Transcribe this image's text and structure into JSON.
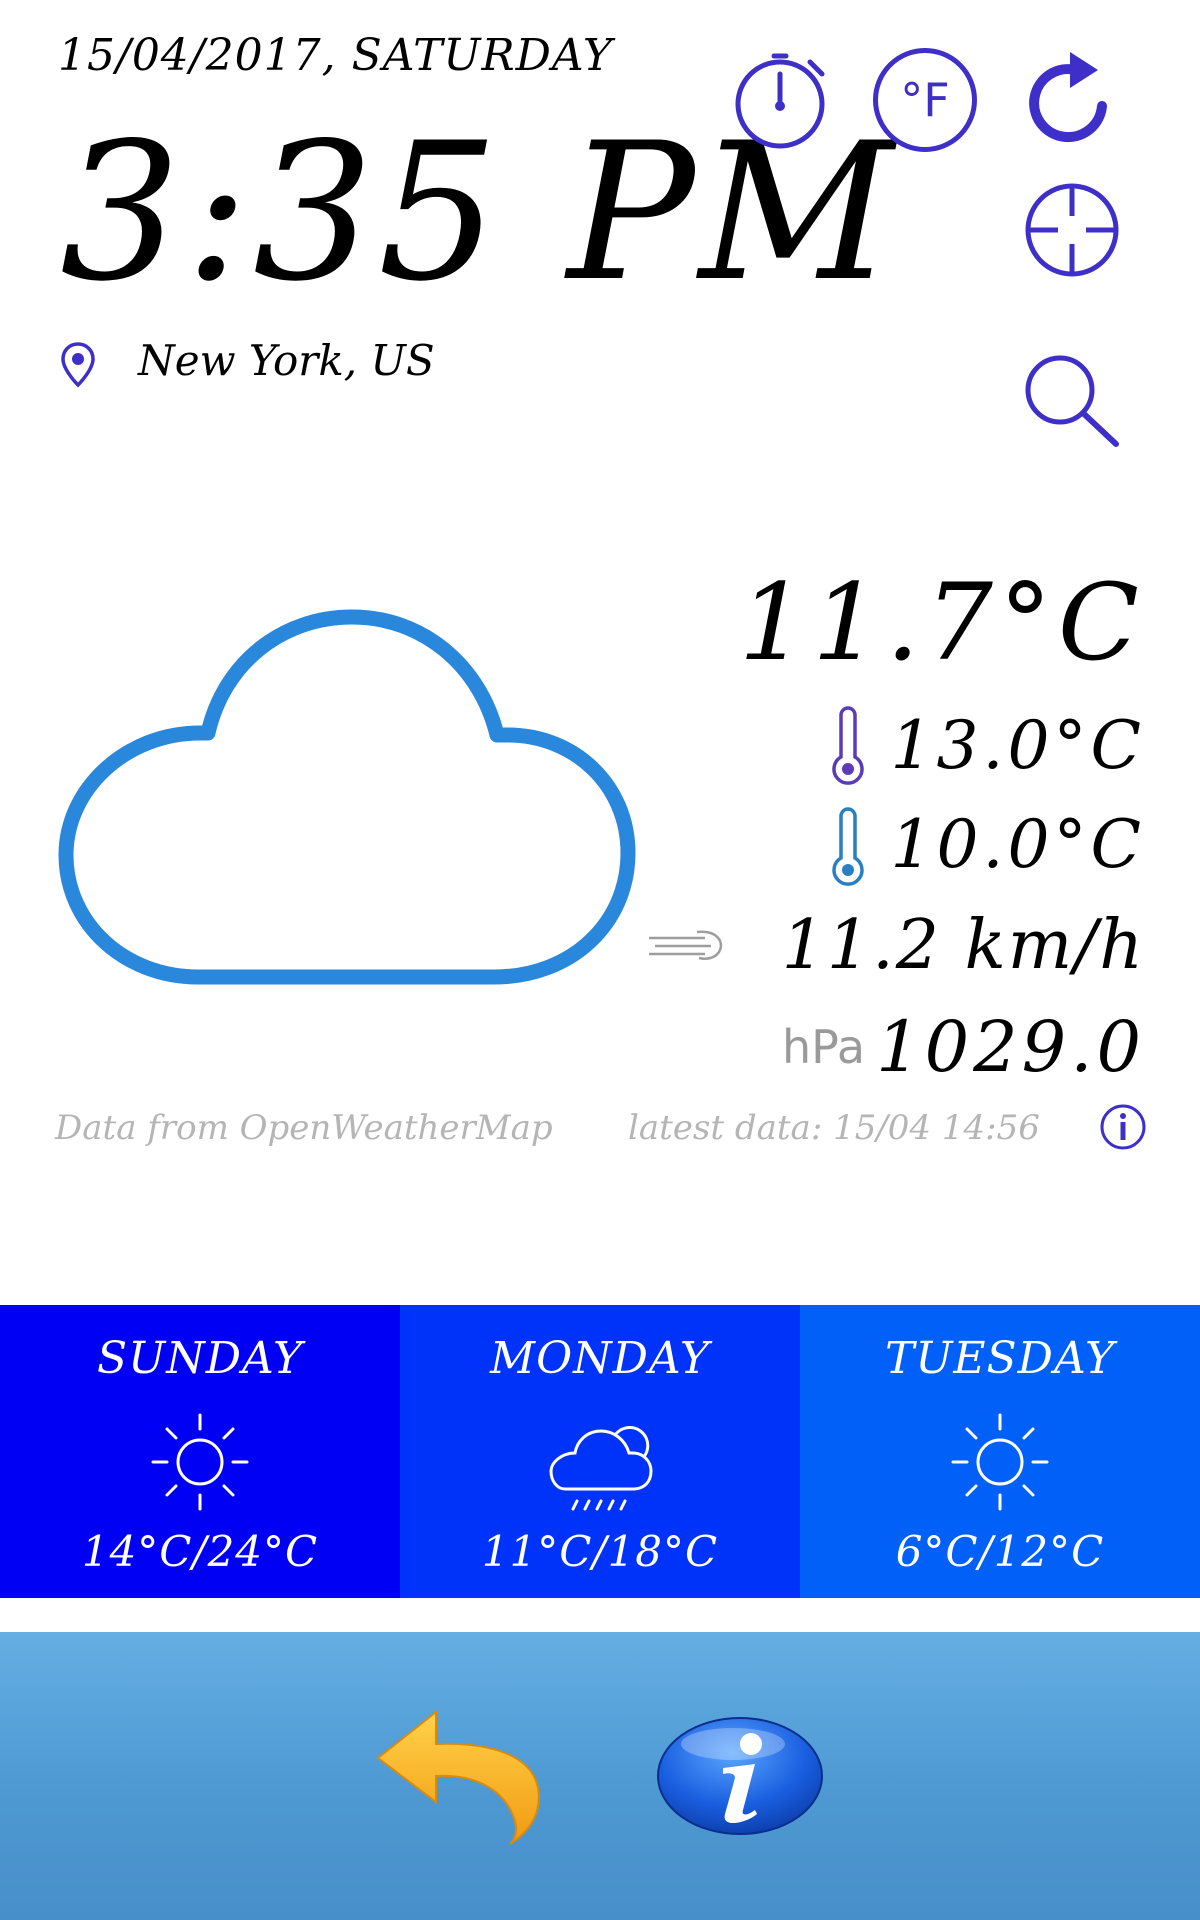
{
  "header": {
    "date": "15/04/2017, SATURDAY",
    "time": "3:35 PM",
    "location": "New York, US"
  },
  "icons": {
    "timer": "stopwatch-icon",
    "unit_toggle": "fahrenheit-icon",
    "unit_toggle_label": "°F",
    "refresh": "refresh-icon",
    "locate": "crosshair-icon",
    "search": "search-icon",
    "location": "location-pin-icon",
    "condition": "cloud-icon"
  },
  "current": {
    "temperature": "11.7°C",
    "max_temperature": "13.0°C",
    "min_temperature": "10.0°C",
    "wind_speed": "11.2 km/h",
    "pressure_unit": "hPa",
    "pressure": "1029.0"
  },
  "footer_info": {
    "source": "Data from OpenWeatherMap",
    "latest": "latest data: 15/04 14:56"
  },
  "forecast": [
    {
      "day": "SUNDAY",
      "icon": "sun-icon",
      "range": "14°C/24°C",
      "color": "#0000f5"
    },
    {
      "day": "MONDAY",
      "icon": "rain-cloud-icon",
      "range": "11°C/18°C",
      "color": "#0033fa"
    },
    {
      "day": "TUESDAY",
      "icon": "sun-icon",
      "range": "6°C/12°C",
      "color": "#0060f8"
    }
  ],
  "colors": {
    "accent": "#3d2fc8",
    "cloud": "#2a88dc",
    "bottom_bar": "#5aa3dc",
    "back_arrow": "#f6a81a"
  },
  "bottom_bar": {
    "back_icon": "back-arrow-icon",
    "info_icon": "info-icon"
  }
}
